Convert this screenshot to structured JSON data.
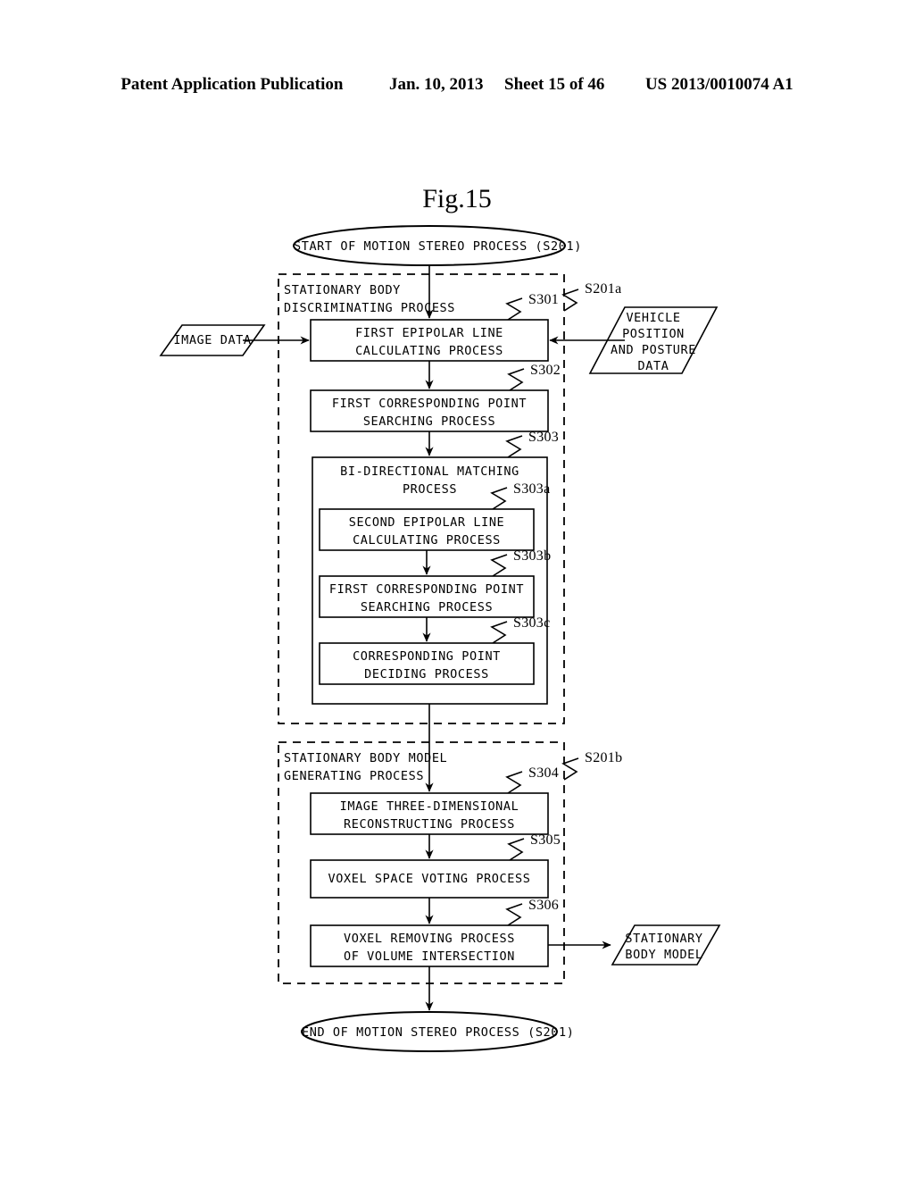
{
  "header": {
    "publication": "Patent Application Publication",
    "date": "Jan. 10, 2013",
    "sheet": "Sheet 15 of 46",
    "docnum": "US 2013/0010074 A1"
  },
  "figure": {
    "title": "Fig.15",
    "start_node": "START OF MOTION STEREO PROCESS  (S201)",
    "end_node": "END OF MOTION STEREO PROCESS  (S201)",
    "groups": [
      {
        "id": "stationary-body-discriminating",
        "label": "STATIONARY BODY\nDISCRIMINATING PROCESS",
        "ref": "S201a"
      },
      {
        "id": "stationary-body-model-generating",
        "label": "STATIONARY BODY MODEL\nGENERATING PROCESS",
        "ref": "S201b"
      }
    ],
    "steps": [
      {
        "id": "s301",
        "ref": "S301",
        "label": "FIRST EPIPOLAR LINE\nCALCULATING PROCESS"
      },
      {
        "id": "s302",
        "ref": "S302",
        "label": "FIRST CORRESPONDING POINT\nSEARCHING PROCESS"
      },
      {
        "id": "s303",
        "ref": "S303",
        "label": "BI-DIRECTIONAL MATCHING PROCESS"
      },
      {
        "id": "s303a",
        "ref": "S303a",
        "label": "SECOND EPIPOLAR LINE\nCALCULATING PROCESS"
      },
      {
        "id": "s303b",
        "ref": "S303b",
        "label": "FIRST CORRESPONDING POINT\nSEARCHING PROCESS"
      },
      {
        "id": "s303c",
        "ref": "S303c",
        "label": "CORRESPONDING POINT\nDECIDING PROCESS"
      },
      {
        "id": "s304",
        "ref": "S304",
        "label": "IMAGE THREE-DIMENSIONAL\nRECONSTRUCTING PROCESS"
      },
      {
        "id": "s305",
        "ref": "S305",
        "label": "VOXEL SPACE VOTING PROCESS"
      },
      {
        "id": "s306",
        "ref": "S306",
        "label": "VOXEL REMOVING PROCESS\nOF VOLUME INTERSECTION"
      }
    ],
    "data_nodes": [
      {
        "id": "image-data",
        "label": "IMAGE DATA"
      },
      {
        "id": "vehicle-position-posture-data",
        "label": "VEHICLE\nPOSITION\nAND POSTURE\nDATA"
      },
      {
        "id": "stationary-body-model",
        "label": "STATIONARY\nBODY MODEL"
      }
    ],
    "colors": {
      "ink": "#000000",
      "paper": "#ffffff"
    }
  }
}
